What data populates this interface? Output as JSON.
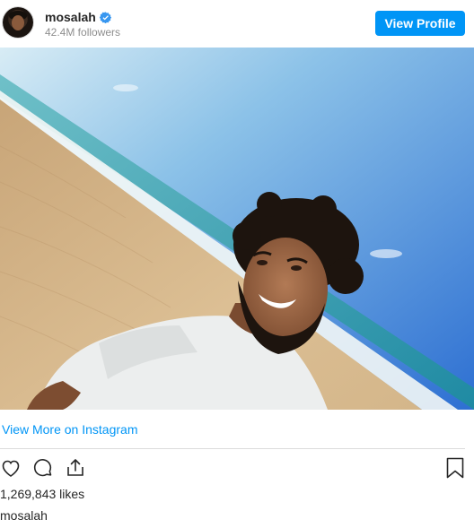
{
  "header": {
    "username": "mosalah",
    "followers": "42.4M followers",
    "view_profile_label": "View Profile",
    "verified_color": "#3897f0"
  },
  "post": {
    "image_icon": "post-photo",
    "view_more_label": "View More on Instagram",
    "likes": "1,269,843 likes",
    "caption_username": "mosalah"
  },
  "actions": {
    "icons": [
      "heart-icon",
      "comment-icon",
      "share-icon",
      "bookmark-icon"
    ]
  },
  "colors": {
    "accent": "#0095f6",
    "text": "#262626",
    "muted": "#8e8e8e",
    "divider": "#dbdbdb"
  }
}
